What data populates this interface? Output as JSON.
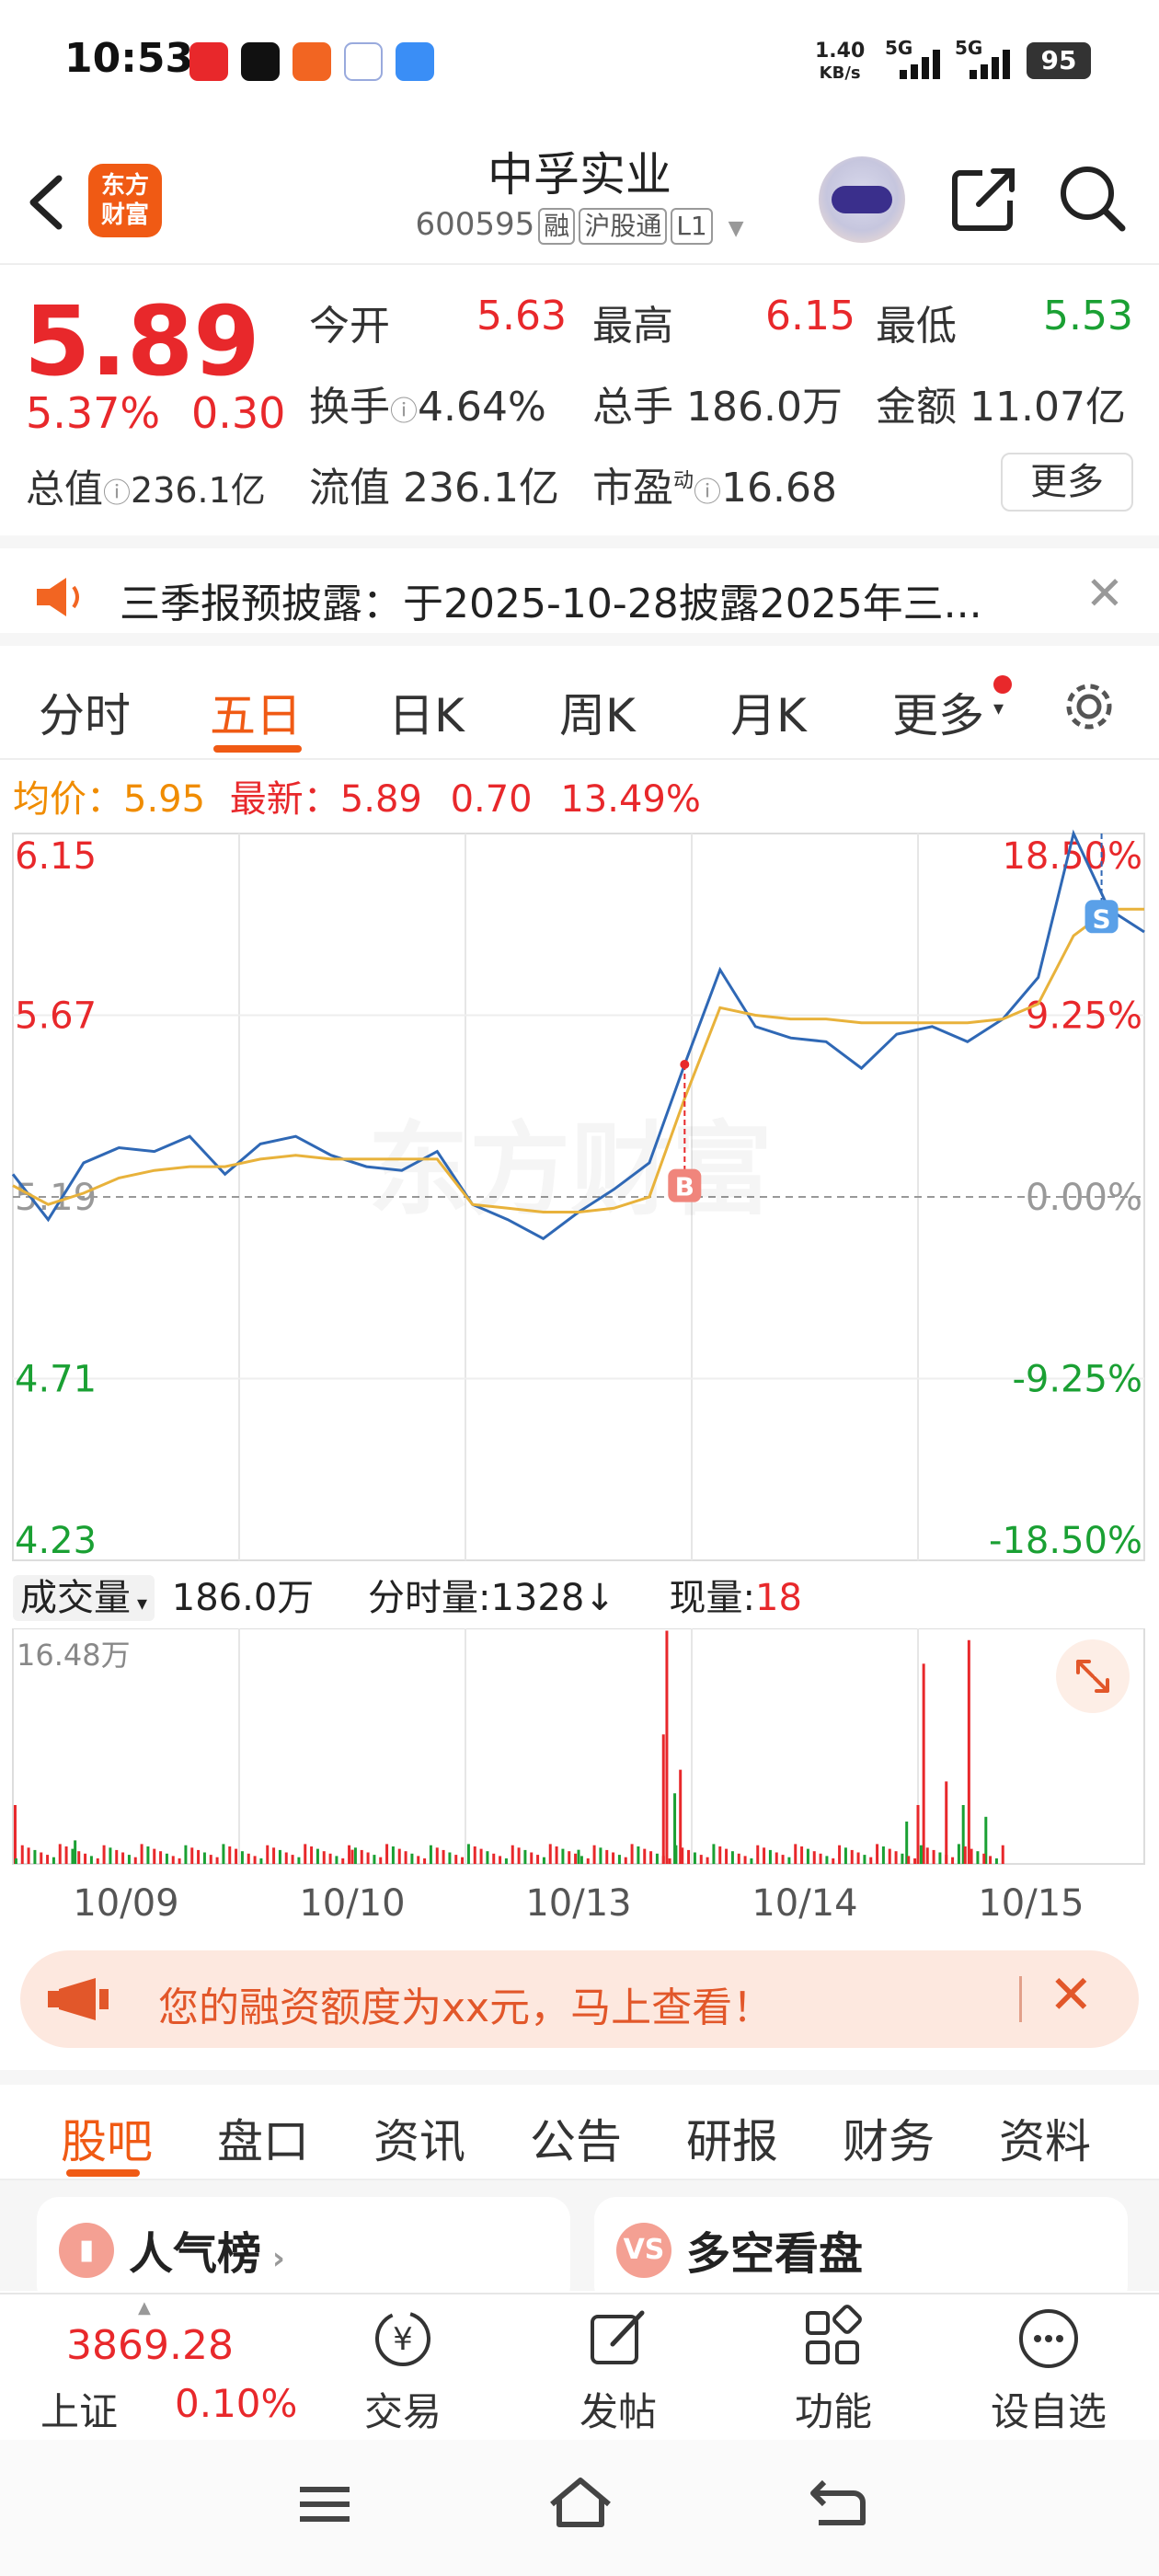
{
  "status": {
    "time": "10:53",
    "net_speed": "1.40",
    "net_unit": "KB/s",
    "sig1": "5G",
    "sig2": "5G",
    "battery": "95"
  },
  "header": {
    "logo_line1": "东方",
    "logo_line2": "财富",
    "stock_name": "中孚实业",
    "stock_code": "600595",
    "tags": [
      "融",
      "沪股通",
      "L1"
    ]
  },
  "quote": {
    "price": "5.89",
    "change_pct": "5.37%",
    "change": "0.30",
    "open_label": "今开",
    "open": "5.63",
    "high_label": "最高",
    "high": "6.15",
    "low_label": "最低",
    "low": "5.53",
    "turnover_label": "换手",
    "turnover": "4.64%",
    "volume_label": "总手",
    "volume": "186.0万",
    "amount_label": "金额",
    "amount": "11.07亿",
    "total_cap_label": "总值",
    "total_cap": "236.1亿",
    "float_cap_label": "流值",
    "float_cap": "236.1亿",
    "pe_label": "市盈",
    "pe_sup": "动",
    "pe": "16.68",
    "more": "更多"
  },
  "notice": {
    "text": "三季报预披露：于2025-10-28披露2025年三..."
  },
  "chart_tabs": [
    "分时",
    "五日",
    "日K",
    "周K",
    "月K",
    "更多"
  ],
  "chart_info": {
    "avg_label": "均价：",
    "avg": "5.95",
    "latest_label": "最新：",
    "latest": "5.89",
    "chg": "0.70",
    "pct": "13.49%"
  },
  "chart_data": {
    "type": "line",
    "x": [
      "10/09",
      "10/10",
      "10/13",
      "10/14",
      "10/15"
    ],
    "y_ticks_left": [
      "6.15",
      "5.67",
      "5.19",
      "4.71",
      "4.23"
    ],
    "y_ticks_right": [
      "18.50%",
      "9.25%",
      "0.00%",
      "-9.25%",
      "-18.50%"
    ],
    "ylim": [
      4.23,
      6.15
    ],
    "base": 5.19,
    "series": [
      {
        "values": [
          5.25,
          5.13,
          5.28,
          5.32,
          5.31,
          5.35,
          5.25,
          5.33,
          5.35,
          5.3,
          5.27,
          5.26,
          5.31,
          5.17,
          5.13,
          5.08,
          5.15,
          5.21,
          5.28,
          5.54,
          5.79,
          5.64,
          5.61,
          5.6,
          5.53,
          5.62,
          5.64,
          5.6,
          5.66,
          5.77,
          6.15,
          5.95,
          5.89
        ]
      },
      {
        "values": [
          5.22,
          5.17,
          5.2,
          5.24,
          5.26,
          5.27,
          5.27,
          5.29,
          5.3,
          5.29,
          5.29,
          5.29,
          5.29,
          5.17,
          5.16,
          5.15,
          5.15,
          5.16,
          5.19,
          5.45,
          5.69,
          5.67,
          5.66,
          5.66,
          5.65,
          5.65,
          5.65,
          5.65,
          5.66,
          5.7,
          5.88,
          5.95,
          5.95
        ]
      }
    ],
    "markers": [
      {
        "label": "B"
      },
      {
        "label": "S"
      }
    ]
  },
  "volume": {
    "label": "成交量",
    "total": "186.0万",
    "per_min_label": "分时量:",
    "per_min": "1328",
    "arrow": "↓",
    "now_label": "现量:",
    "now": "18",
    "max_label": "16.48万"
  },
  "banner": {
    "text": "您的融资额度为xx元，马上查看！"
  },
  "section_tabs": [
    "股吧",
    "盘口",
    "资讯",
    "公告",
    "研报",
    "财务",
    "资料"
  ],
  "cards": [
    {
      "title": "人气榜",
      "icon": "hot-rank-icon"
    },
    {
      "title": "多空看盘",
      "icon": "vs-icon",
      "icon_text": "VS"
    }
  ],
  "bottom_nav": {
    "index_value": "3869.28",
    "index_name": "上证",
    "index_pct": "0.10%",
    "items": [
      "交易",
      "发帖",
      "功能",
      "设自选"
    ]
  }
}
